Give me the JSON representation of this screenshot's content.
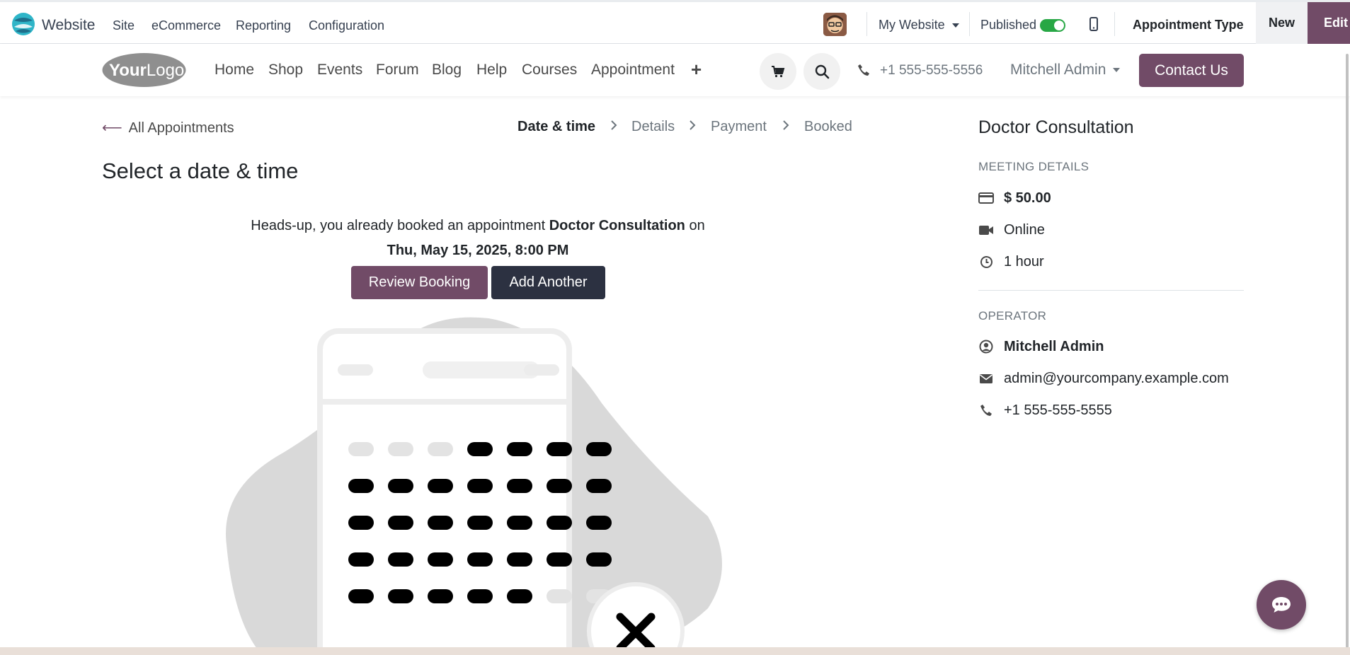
{
  "topbar": {
    "app_name": "Website",
    "menu": [
      "Site",
      "eCommerce",
      "Reporting",
      "Configuration"
    ],
    "my_website": "My Website",
    "published": "Published",
    "published_on": true,
    "record_type": "Appointment Type",
    "new_label": "New",
    "edit_label": "Edit"
  },
  "navbar": {
    "logo": "YourLogo",
    "items": [
      "Home",
      "Shop",
      "Events",
      "Forum",
      "Blog",
      "Help",
      "Courses",
      "Appointment"
    ],
    "phone": "+1 555-555-5556",
    "user": "Mitchell Admin",
    "contact": "Contact Us"
  },
  "main": {
    "back_link": "All Appointments",
    "steps": [
      "Date & time",
      "Details",
      "Payment",
      "Booked"
    ],
    "active_step": 0,
    "title": "Select a date & time",
    "notice_prefix": "Heads-up, you already booked an appointment",
    "notice_appointment": "Doctor Consultation",
    "notice_on": "on",
    "notice_datetime": "Thu, May 15, 2025, 8:00 PM",
    "review_button": "Review Booking",
    "add_button": "Add Another"
  },
  "sidebar": {
    "title": "Doctor Consultation",
    "meeting_label": "MEETING DETAILS",
    "price": "$ 50.00",
    "location": "Online",
    "duration": "1 hour",
    "operator_label": "OPERATOR",
    "operator_name": "Mitchell Admin",
    "operator_email": "admin@yourcompany.example.com",
    "operator_phone": "+1 555-555-5555"
  },
  "colors": {
    "brand": "#714b67",
    "dark_button": "#2c3141",
    "toggle_on": "#28a745"
  },
  "icons": [
    "website-app-icon",
    "cart-icon",
    "search-icon",
    "phone-icon",
    "credit-card-icon",
    "video-icon",
    "clock-icon",
    "user-circle-icon",
    "envelope-icon",
    "chat-icon",
    "mobile-icon"
  ]
}
